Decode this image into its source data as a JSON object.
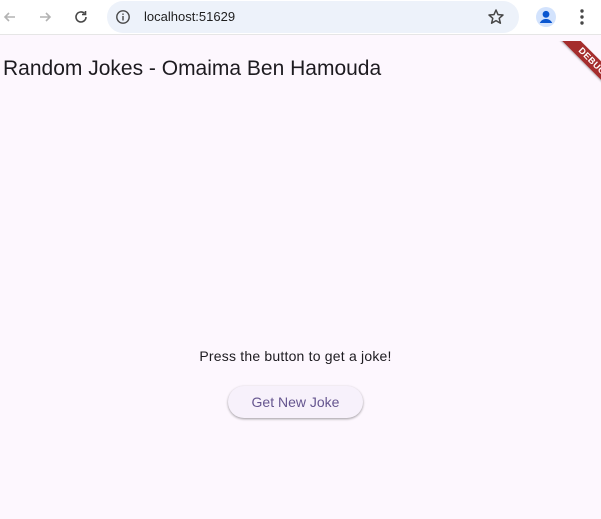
{
  "browser": {
    "url": "localhost:51629",
    "icons": {
      "back": "arrow-left-icon",
      "forward": "arrow-right-icon",
      "reload": "reload-icon",
      "site_info": "info-icon",
      "bookmark": "star-icon",
      "profile": "profile-icon",
      "menu": "more-vert-icon"
    }
  },
  "app": {
    "title": "Random Jokes - Omaima Ben Hamouda",
    "prompt": "Press the button to get a joke!",
    "button_label": "Get New Joke",
    "debug_banner": "DEBUG"
  },
  "colors": {
    "background": "#fdf7fe",
    "button_text": "#65558f",
    "button_bg": "#f7f1fb",
    "debug_banner": "#a52d2d",
    "omnibox_bg": "#edf2fa",
    "profile_accent": "#0b57d0"
  }
}
